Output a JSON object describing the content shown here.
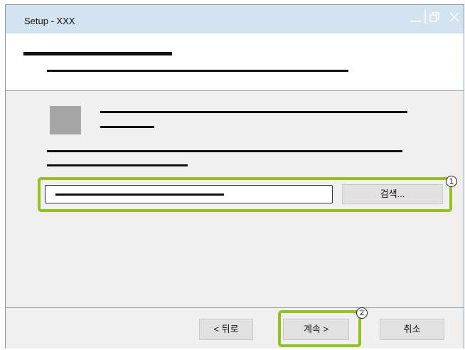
{
  "window": {
    "title": "Setup - XXX"
  },
  "path_group": {
    "callout": "1",
    "browse_label": "검색..."
  },
  "footer": {
    "callout": "2",
    "back_label": "< 뒤로",
    "next_label": "계속 >",
    "cancel_label": "취소"
  },
  "colors": {
    "titlebar": "#d4e3f2",
    "highlight": "#95c11f",
    "button": "#e1e1e1",
    "placeholder_icon": "#a6a6a6"
  },
  "icons": [
    "minimize-icon",
    "restore-icon",
    "close-icon",
    "package-icon"
  ]
}
